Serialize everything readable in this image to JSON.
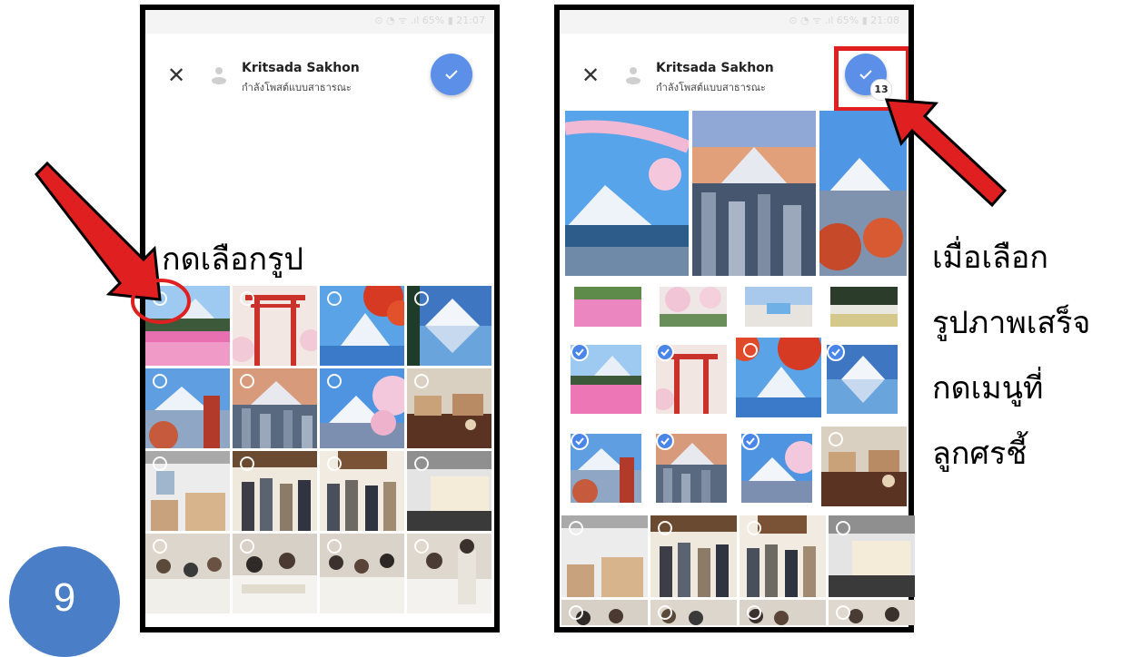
{
  "status_bar": {
    "text": "⊙ ◔ ᯤ .ıl 65% ▮ 21:07"
  },
  "status_bar_right": {
    "text": "⊙ ◔ ᯤ .ıl 65% ▮ 21:08"
  },
  "composer": {
    "user_name": "Kritsada Sakhon",
    "post_status": "กำลังโพสต์แบบสาธารณะ",
    "selected_count": "13"
  },
  "instruction_left": "กดเลือกรูป",
  "instruction_right": [
    "เมื่อเลือก",
    "รูปภาพเสร็จ",
    "กดเมนูที่",
    "ลูกศรชี้"
  ],
  "step_number": "9",
  "colors": {
    "accent": "#5b8fe8",
    "arrow": "#e02020",
    "badge": "#4a7ec6"
  },
  "icons": {
    "close": "close-icon",
    "confirm": "check-icon",
    "avatar": "avatar-icon"
  },
  "photos": {
    "left_grid": [
      "flower-field",
      "torii-gate",
      "fuji-maple",
      "fuji-lake",
      "fuji-pagoda",
      "fuji-city",
      "fuji-blossom",
      "market-stall",
      "booth",
      "clothes-shop",
      "clothes-shop",
      "exhibition",
      "workshop",
      "workshop",
      "workshop",
      "workshop"
    ],
    "right_grid_selected": [
      true,
      true,
      false,
      true,
      true,
      true,
      true,
      false
    ]
  }
}
